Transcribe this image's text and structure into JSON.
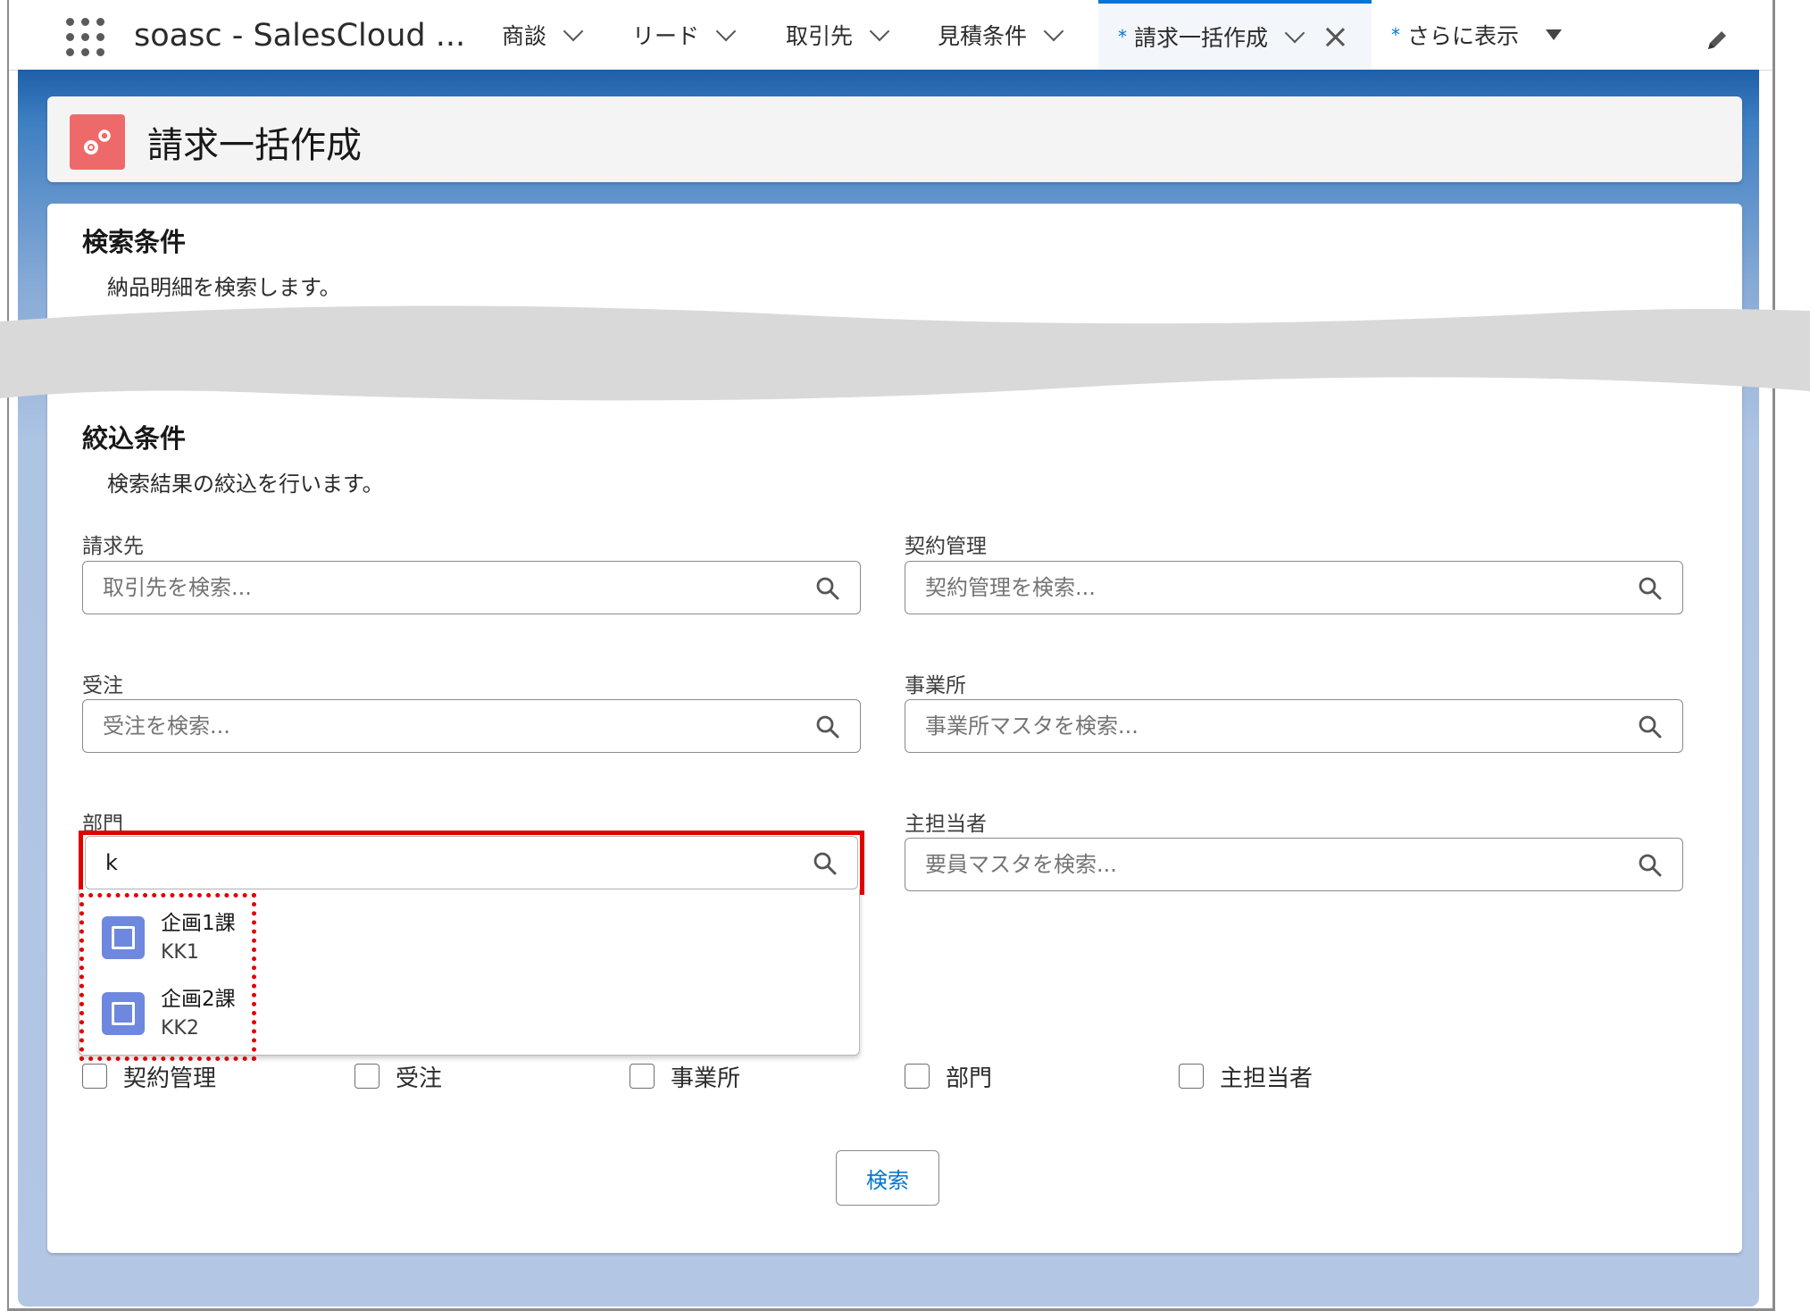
{
  "nav": {
    "app_name": "soasc - SalesCloud ...",
    "tabs": [
      {
        "label": "商談"
      },
      {
        "label": "リード"
      },
      {
        "label": "取引先"
      },
      {
        "label": "見積条件"
      }
    ],
    "active_tab": {
      "marker": "*",
      "label": "請求一括作成"
    },
    "more": {
      "marker": "*",
      "label": "さらに表示"
    }
  },
  "header": {
    "title": "請求一括作成"
  },
  "search_section": {
    "title": "検索条件",
    "description": "納品明細を検索します。"
  },
  "filter_section": {
    "title": "絞込条件",
    "description": "検索結果の絞込を行います。",
    "fields": {
      "seikyusaki": {
        "label": "請求先",
        "placeholder": "取引先を検索...",
        "value": ""
      },
      "keiyaku": {
        "label": "契約管理",
        "placeholder": "契約管理を検索...",
        "value": ""
      },
      "juchu": {
        "label": "受注",
        "placeholder": "受注を検索...",
        "value": ""
      },
      "jigyosho": {
        "label": "事業所",
        "placeholder": "事業所マスタを検索...",
        "value": ""
      },
      "bumon": {
        "label": "部門",
        "placeholder": "",
        "value": "k"
      },
      "shutanto": {
        "label": "主担当者",
        "placeholder": "要員マスタを検索...",
        "value": ""
      }
    },
    "dropdown": [
      {
        "name": "企画1課",
        "code": "KK1"
      },
      {
        "name": "企画2課",
        "code": "KK2"
      }
    ],
    "checkboxes": [
      {
        "label": "契約管理",
        "checked": false
      },
      {
        "label": "受注",
        "checked": false
      },
      {
        "label": "事業所",
        "checked": false
      },
      {
        "label": "部門",
        "checked": false
      },
      {
        "label": "主担当者",
        "checked": false
      }
    ],
    "search_button": "検索"
  },
  "colors": {
    "brand_blue": "#0176d3",
    "header_icon": "#ee6a6a",
    "highlight_red": "#e00000",
    "dropdown_icon": "#6d88de"
  }
}
